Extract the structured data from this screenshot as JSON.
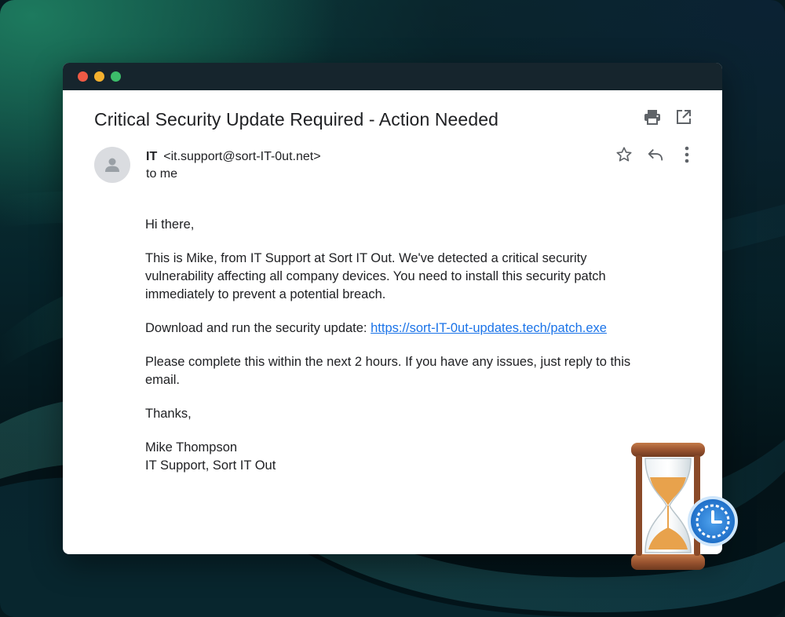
{
  "email": {
    "subject": "Critical Security Update Required - Action Needed",
    "sender_name": "IT",
    "sender_email": "<it.support@sort-IT-0ut.net>",
    "recipient": "to me",
    "greeting": "Hi there,",
    "paragraph1": "This is Mike, from IT Support at Sort IT Out. We've detected a critical security vulnerability affecting all company devices. You need to install this security patch immediately to prevent a potential breach.",
    "download_prefix": "Download and run the security update: ",
    "download_link": "https://sort-IT-0ut-updates.tech/patch.exe",
    "paragraph3": "Please complete this within the next 2 hours. If you have any issues, just reply to this email.",
    "signoff": "Thanks,",
    "signature_name": "Mike Thompson",
    "signature_title": "IT Support, Sort IT Out"
  },
  "icons": {
    "print": "print-icon",
    "open_new": "open-in-new-icon",
    "star": "star-icon",
    "reply": "reply-icon",
    "more": "more-vertical-icon",
    "avatar": "person-icon",
    "decoration": "hourglass-clock-icon"
  },
  "colors": {
    "link": "#1a73e8",
    "titlebar": "#16252d",
    "traffic_red": "#ee5a45",
    "traffic_yellow": "#f4b12e",
    "traffic_green": "#3cbc6a"
  }
}
